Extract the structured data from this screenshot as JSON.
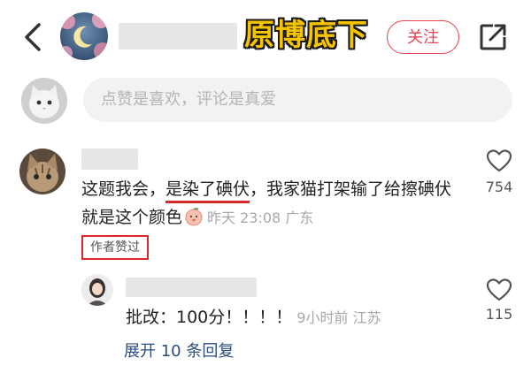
{
  "header": {
    "follow_label": "关注",
    "overlay_title": "原博底下"
  },
  "input": {
    "placeholder": "点赞是喜欢，评论是真爱"
  },
  "comment": {
    "text_before": "这题我会，",
    "text_underlined": "是染了碘伏",
    "text_after": "，我家猫打架输了给擦碘伏就是这个颜色",
    "time": "昨天 23:08",
    "location": "广东",
    "author_liked_badge": "作者赞过",
    "like_count": "754"
  },
  "reply": {
    "text": "批改：100分！！！！",
    "time": "9小时前",
    "location": "江苏",
    "like_count": "115"
  },
  "expand_label": "展开 10 条回复",
  "colors": {
    "accent_red": "#e8434f",
    "link_blue": "#2b4d7e",
    "overlay_yellow": "#f5c400"
  }
}
